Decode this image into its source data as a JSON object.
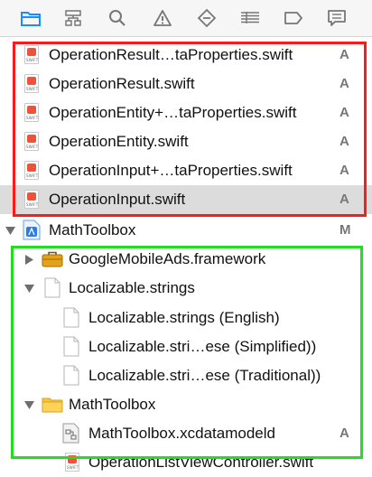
{
  "toolbar": {
    "icons": [
      "folder-icon",
      "hierarchy-icon",
      "search-icon",
      "warning-icon",
      "diamond-icon",
      "list-icon",
      "tag-icon",
      "comment-icon"
    ]
  },
  "files": [
    {
      "name": "OperationResult…taProperties.swift",
      "status": "A"
    },
    {
      "name": "OperationResult.swift",
      "status": "A"
    },
    {
      "name": "OperationEntity+…taProperties.swift",
      "status": "A"
    },
    {
      "name": "OperationEntity.swift",
      "status": "A"
    },
    {
      "name": "OperationInput+…taProperties.swift",
      "status": "A"
    },
    {
      "name": "OperationInput.swift",
      "status": "A"
    }
  ],
  "project": {
    "name": "MathToolbox",
    "status": "M"
  },
  "children": {
    "framework": {
      "name": "GoogleMobileAds.framework"
    },
    "strings": {
      "name": "Localizable.strings"
    },
    "strings_english": {
      "name": "Localizable.strings (English)"
    },
    "strings_simplified": {
      "name": "Localizable.stri…ese (Simplified))"
    },
    "strings_traditional": {
      "name": "Localizable.stri…ese (Traditional))"
    },
    "folder": {
      "name": "MathToolbox"
    },
    "datamodel": {
      "name": "MathToolbox.xcdatamodeld",
      "status": "A"
    },
    "partial": {
      "name": "OperationListViewController.swift"
    }
  },
  "colors": {
    "highlight_red": "#ff1a1a",
    "highlight_green": "#22dd22",
    "accent": "#1a8cff"
  }
}
